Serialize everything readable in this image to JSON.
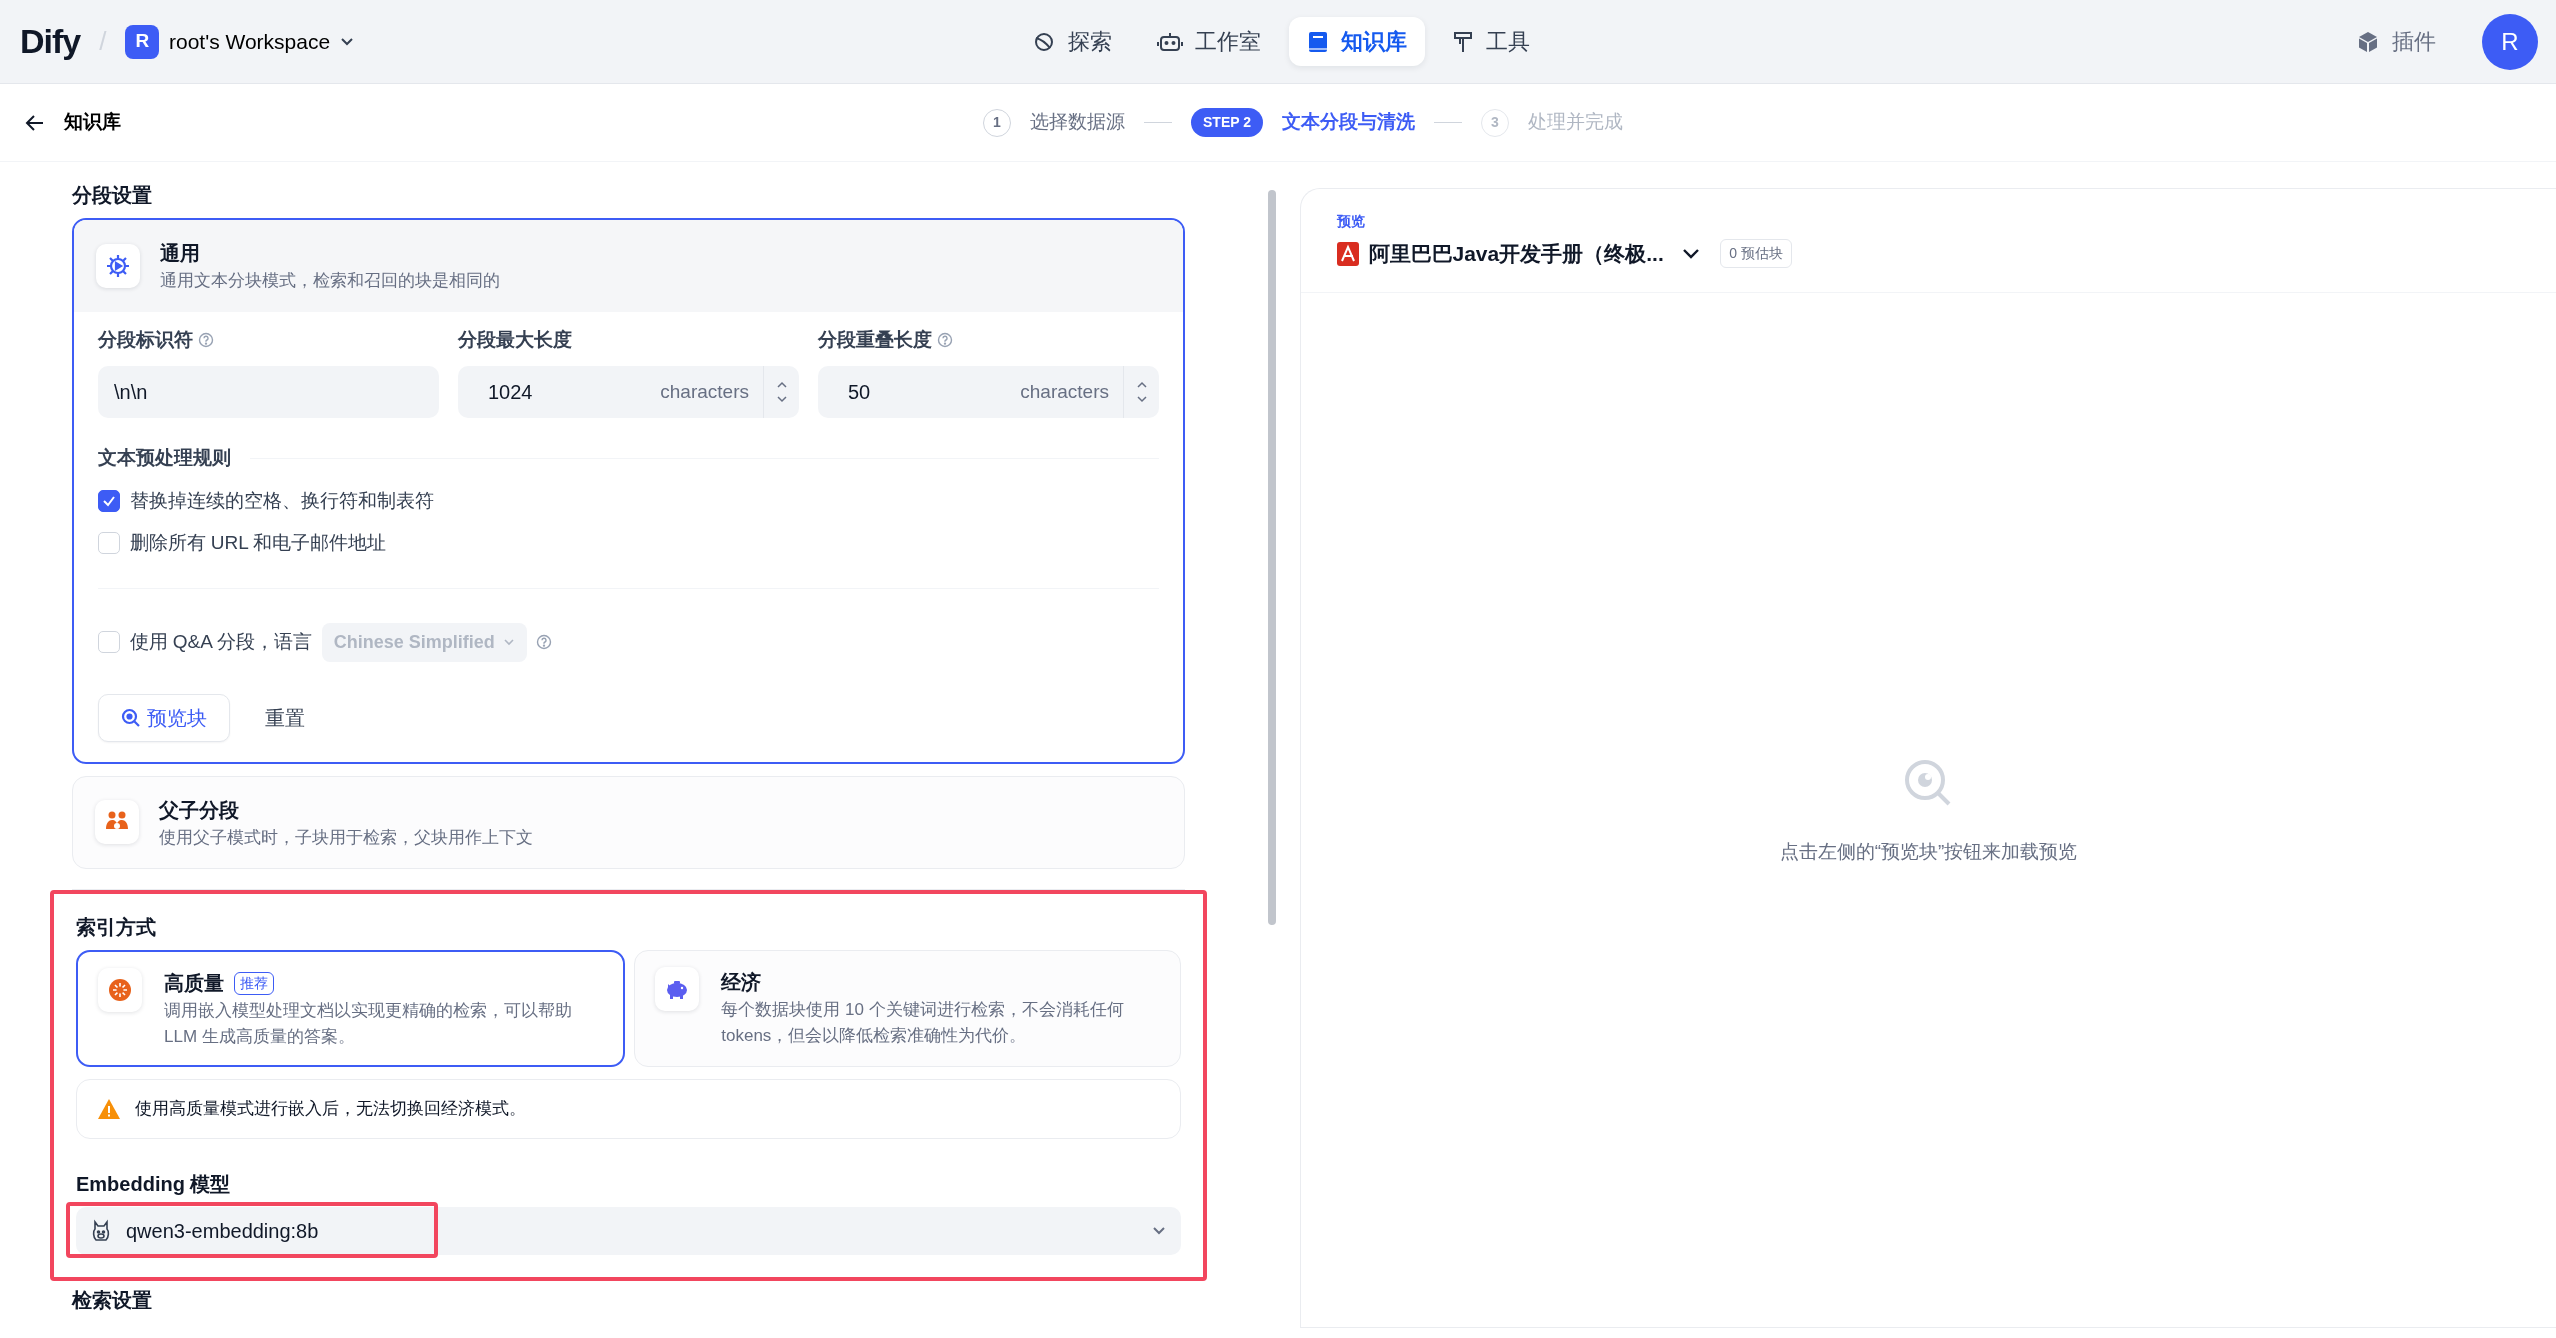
{
  "top_nav": {
    "logo": "Dify",
    "separator": "/",
    "workspace": {
      "initial": "R",
      "name": "root's Workspace"
    },
    "tabs": [
      {
        "label": "探索",
        "selected": false
      },
      {
        "label": "工作室",
        "selected": false
      },
      {
        "label": "知识库",
        "selected": true
      },
      {
        "label": "工具",
        "selected": false
      }
    ],
    "plugins": "插件",
    "avatar": "R"
  },
  "breadcrumb": {
    "back_label": "知识库"
  },
  "steps": [
    {
      "marker": "1",
      "label": "选择数据源",
      "selected": false,
      "completed": true
    },
    {
      "marker": "STEP 2",
      "label": "文本分段与清洗",
      "selected": true,
      "completed": false
    },
    {
      "marker": "3",
      "label": "处理并完成",
      "selected": false,
      "completed": false
    }
  ],
  "chunk_settings": {
    "title": "分段设置",
    "modes": [
      {
        "title": "通用",
        "description": "通用文本分块模式，检索和召回的块是相同的",
        "selected": true
      },
      {
        "title": "父子分段",
        "description": "使用父子模式时，子块用于检索，父块用作上下文",
        "selected": false
      }
    ],
    "fields": [
      {
        "label": "分段标识符",
        "help": true,
        "value": "\\n\\n"
      },
      {
        "label": "分段最大长度",
        "help": false,
        "value": "1024",
        "unit": "characters"
      },
      {
        "label": "分段重叠长度",
        "help": true,
        "value": "50",
        "unit": "characters"
      }
    ],
    "rules_title": "文本预处理规则",
    "rules": [
      {
        "label": "替换掉连续的空格、换行符和制表符",
        "checked": true
      },
      {
        "label": "删除所有 URL 和电子邮件地址",
        "checked": false
      }
    ],
    "qa": {
      "label": "使用 Q&A 分段，语言",
      "checked": false,
      "language": "Chinese Simplified"
    },
    "preview_button": "预览块",
    "reset_button": "重置"
  },
  "index_method": {
    "title": "索引方式",
    "highlighted": true,
    "options": [
      {
        "title": "高质量",
        "badge": "推荐",
        "description": "调用嵌入模型处理文档以实现更精确的检索，可以帮助LLM 生成高质量的答案。",
        "selected": true
      },
      {
        "title": "经济",
        "description": "每个数据块使用 10 个关键词进行检索，不会消耗任何 tokens，但会以降低检索准确性为代价。",
        "selected": false
      }
    ],
    "warning": "使用高质量模式进行嵌入后，无法切换回经济模式。"
  },
  "embedding": {
    "label": "Embedding 模型",
    "model": "qwen3-embedding:8b",
    "highlighted": true
  },
  "retrieval": {
    "title": "检索设置"
  },
  "preview": {
    "label": "预览",
    "document": "阿里巴巴Java开发手册（终极...",
    "chunk_count": "0 预估块",
    "empty_message": "点击左侧的“预览块”按钮来加载预览"
  }
}
